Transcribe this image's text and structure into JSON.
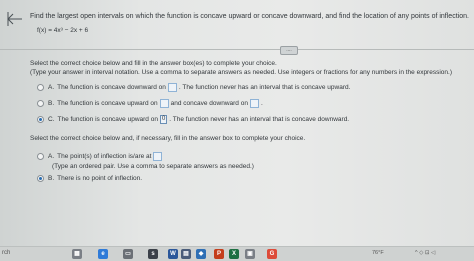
{
  "question": {
    "text": "Find the largest open intervals on which the function is concave upward or concave downward, and find the location of any points of inflection.",
    "function": "f(x) = 4x³ − 2x + 6"
  },
  "part1": {
    "instruction1": "Select the correct choice below and fill in the answer box(es) to complete your choice.",
    "instruction2": "(Type your answer in interval notation. Use a comma to separate answers as needed. Use integers or fractions for any numbers in the expression.)",
    "options": [
      {
        "letter": "A.",
        "pre": "The function is concave downward on",
        "post": ". The function never has an interval that is concave upward."
      },
      {
        "letter": "B.",
        "pre": "The function is concave upward on",
        "mid": "and concave downward on",
        "post": "."
      },
      {
        "letter": "C.",
        "pre": "The function is concave upward on",
        "box_value": "0",
        "post": ". The function never has an interval that is concave downward."
      }
    ]
  },
  "part2": {
    "instruction": "Select the correct choice below and, if necessary, fill in the answer box to complete your choice.",
    "options": [
      {
        "letter": "A.",
        "text": "The point(s) of inflection is/are at",
        "hint": "(Type an ordered pair. Use a comma to separate answers as needed.)"
      },
      {
        "letter": "B.",
        "text": "There is no point of inflection."
      }
    ]
  },
  "more_label": "....",
  "taskbar": {
    "search": "rch",
    "tray_left": "76°F",
    "tray_right": "^ ◇ ⊡ ◁"
  },
  "colors": {
    "accent": "#2a6db0",
    "box_border": "#8fb3d6"
  }
}
